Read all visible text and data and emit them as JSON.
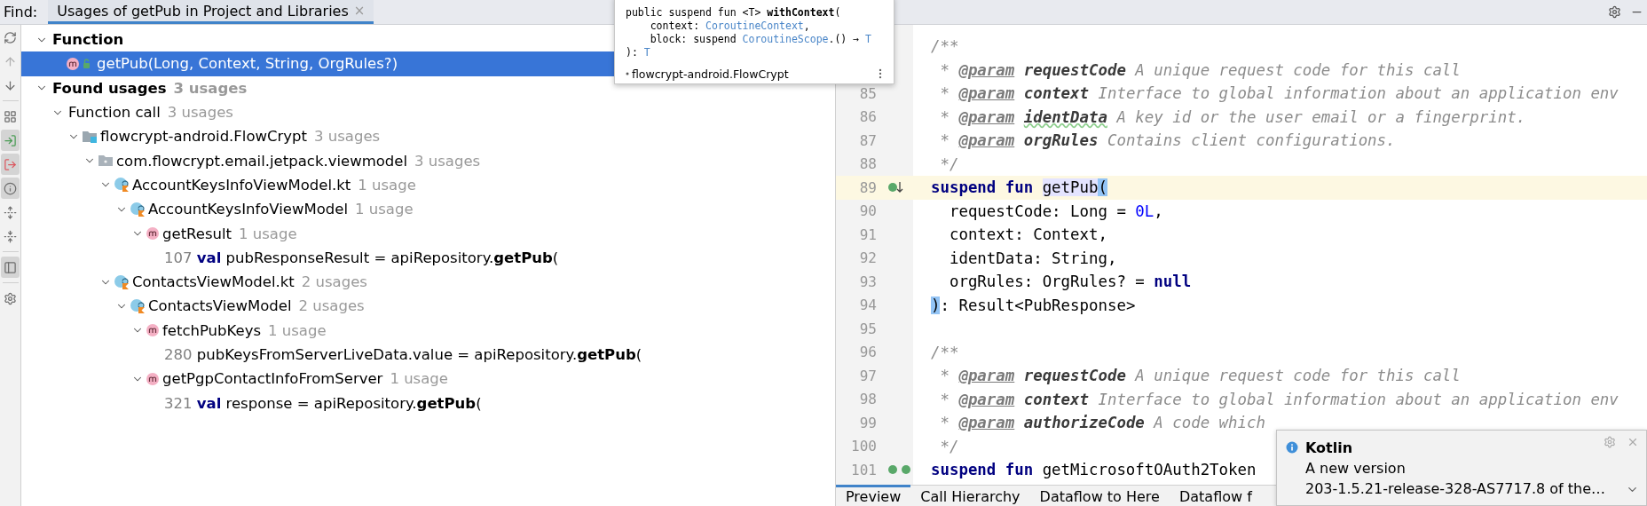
{
  "find_bar": {
    "label": "Find:",
    "tabs": [
      {
        "label": "Usages of getPub in Project and Libraries",
        "selected": true,
        "close": "×"
      }
    ]
  },
  "toolbar": [
    {
      "kind": "refresh",
      "on": false,
      "disabled": false
    },
    {
      "kind": "previous",
      "on": false,
      "disabled": true
    },
    {
      "kind": "next",
      "on": false,
      "disabled": false
    },
    {
      "kind": "separator"
    },
    {
      "kind": "group",
      "on": false,
      "disabled": false
    },
    {
      "kind": "import",
      "on": true,
      "disabled": false
    },
    {
      "kind": "export",
      "on": true,
      "disabled": false
    },
    {
      "kind": "info",
      "on": true,
      "disabled": false
    },
    {
      "kind": "expand",
      "on": false,
      "disabled": false
    },
    {
      "kind": "collapse",
      "on": false,
      "disabled": false
    },
    {
      "kind": "separator"
    },
    {
      "kind": "preview",
      "on": true,
      "disabled": false
    },
    {
      "kind": "separator"
    },
    {
      "kind": "settings",
      "on": false,
      "disabled": false
    }
  ],
  "tree": [
    {
      "kind": "group",
      "label": "Function",
      "expanded": true,
      "selected": false,
      "children": [
        {
          "kind": "function",
          "label": "getPub(Long, Context, String, OrgRules?)",
          "selected": true
        }
      ]
    },
    {
      "kind": "group",
      "label": "Found usages",
      "count": "3 usages",
      "expanded": true,
      "selected": false,
      "children": [
        {
          "kind": "category",
          "label": "Function call",
          "count": "3 usages",
          "expanded": true,
          "selected": false,
          "children": [
            {
              "kind": "module",
              "label": "flowcrypt-android.FlowCrypt",
              "count": "3 usages",
              "expanded": true,
              "selected": false,
              "children": [
                {
                  "kind": "package",
                  "label": "com.flowcrypt.email.jetpack.viewmodel",
                  "count": "3 usages",
                  "expanded": true,
                  "selected": false,
                  "children": [
                    {
                      "kind": "file",
                      "label": "AccountKeysInfoViewModel.kt",
                      "count": "1 usage",
                      "expanded": true,
                      "selected": false,
                      "children": [
                        {
                          "kind": "class",
                          "label": "AccountKeysInfoViewModel",
                          "count": "1 usage",
                          "expanded": true,
                          "selected": false,
                          "children": [
                            {
                              "kind": "method",
                              "label": "getResult",
                              "count": "1 usage",
                              "expanded": true,
                              "selected": false,
                              "children": [
                                {
                                  "kind": "usage",
                                  "line": "107",
                                  "selected": false,
                                  "code": [
                                    {
                                      "kind": "keyword",
                                      "text": "val"
                                    },
                                    {
                                      "kind": "plain",
                                      "text": " pubResponseResult = apiRepository."
                                    },
                                    {
                                      "kind": "match",
                                      "text": "getPub"
                                    },
                                    {
                                      "kind": "plain",
                                      "text": "("
                                    }
                                  ]
                                }
                              ]
                            }
                          ]
                        }
                      ]
                    },
                    {
                      "kind": "file",
                      "label": "ContactsViewModel.kt",
                      "count": "2 usages",
                      "expanded": true,
                      "selected": false,
                      "children": [
                        {
                          "kind": "class",
                          "label": "ContactsViewModel",
                          "count": "2 usages",
                          "expanded": true,
                          "selected": false,
                          "children": [
                            {
                              "kind": "method",
                              "label": "fetchPubKeys",
                              "count": "1 usage",
                              "expanded": true,
                              "selected": false,
                              "children": [
                                {
                                  "kind": "usage",
                                  "line": "280",
                                  "selected": false,
                                  "code": [
                                    {
                                      "kind": "plain",
                                      "text": "pubKeysFromServerLiveData.value = apiRepository."
                                    },
                                    {
                                      "kind": "match",
                                      "text": "getPub"
                                    },
                                    {
                                      "kind": "plain",
                                      "text": "("
                                    }
                                  ]
                                }
                              ]
                            },
                            {
                              "kind": "method",
                              "label": "getPgpContactInfoFromServer",
                              "count": "1 usage",
                              "expanded": true,
                              "selected": false,
                              "children": [
                                {
                                  "kind": "usage",
                                  "line": "321",
                                  "selected": false,
                                  "code": [
                                    {
                                      "kind": "keyword",
                                      "text": "val"
                                    },
                                    {
                                      "kind": "plain",
                                      "text": " response = apiRepository."
                                    },
                                    {
                                      "kind": "match",
                                      "text": "getPub"
                                    },
                                    {
                                      "kind": "plain",
                                      "text": "("
                                    }
                                  ]
                                }
                              ]
                            }
                          ]
                        }
                      ]
                    }
                  ]
                }
              ]
            }
          ]
        }
      ]
    }
  ],
  "popup": {
    "lines": [
      [
        {
          "kind": "plain",
          "text": "public suspend fun <T> "
        },
        {
          "kind": "bold",
          "text": "withContext"
        },
        {
          "kind": "plain",
          "text": "("
        }
      ],
      [
        {
          "kind": "plain",
          "text": "    context: "
        },
        {
          "kind": "type",
          "text": "CoroutineContext"
        },
        {
          "kind": "plain",
          "text": ","
        }
      ],
      [
        {
          "kind": "plain",
          "text": "    block: suspend "
        },
        {
          "kind": "type",
          "text": "CoroutineScope"
        },
        {
          "kind": "plain",
          "text": ".() → "
        },
        {
          "kind": "type",
          "text": "T"
        }
      ],
      [
        {
          "kind": "plain",
          "text": "): "
        },
        {
          "kind": "type",
          "text": "T"
        }
      ]
    ],
    "footer": "flowcrypt-android.FlowCrypt"
  },
  "editor": {
    "lines": [
      {
        "current": false,
        "tokens": [
          {
            "kind": "comment",
            "text": "/**"
          }
        ]
      },
      {
        "current": false,
        "tokens": [
          {
            "kind": "comment",
            "text": " * "
          },
          {
            "kind": "tag",
            "text": "@param"
          },
          {
            "kind": "param",
            "text": " requestCode"
          },
          {
            "kind": "comment",
            "text": " A unique request code for this call"
          }
        ]
      },
      {
        "number": "85",
        "current": false,
        "tokens": [
          {
            "kind": "comment",
            "text": " * "
          },
          {
            "kind": "tag",
            "text": "@param"
          },
          {
            "kind": "param",
            "text": " context"
          },
          {
            "kind": "comment",
            "text": " Interface to global information about an application env"
          }
        ]
      },
      {
        "number": "86",
        "current": false,
        "tokens": [
          {
            "kind": "comment",
            "text": " * "
          },
          {
            "kind": "tag",
            "text": "@param"
          },
          {
            "kind": "typo-param",
            "text": "identData"
          },
          {
            "kind": "comment",
            "text": " A key id or the user email or a fingerprint."
          }
        ]
      },
      {
        "number": "87",
        "current": false,
        "tokens": [
          {
            "kind": "comment",
            "text": " * "
          },
          {
            "kind": "tag",
            "text": "@param"
          },
          {
            "kind": "param",
            "text": " orgRules"
          },
          {
            "kind": "comment",
            "text": " Contains client configurations."
          }
        ]
      },
      {
        "number": "88",
        "current": false,
        "tokens": [
          {
            "kind": "comment",
            "text": " */"
          }
        ]
      },
      {
        "number": "89",
        "current": true,
        "markers": [
          {
            "kind": "implementation"
          }
        ],
        "tokens": [
          {
            "kind": "keyword",
            "text": "suspend fun "
          },
          {
            "kind": "ref",
            "text": "getPub"
          },
          {
            "kind": "brace",
            "text": "("
          }
        ]
      },
      {
        "number": "90",
        "current": false,
        "tokens": [
          {
            "kind": "plain",
            "text": "  requestCode: Long = "
          },
          {
            "kind": "number",
            "text": "0L"
          },
          {
            "kind": "plain",
            "text": ","
          }
        ]
      },
      {
        "number": "91",
        "current": false,
        "tokens": [
          {
            "kind": "plain",
            "text": "  context: Context,"
          }
        ]
      },
      {
        "number": "92",
        "current": false,
        "tokens": [
          {
            "kind": "plain",
            "text": "  identData: String,"
          }
        ]
      },
      {
        "number": "93",
        "current": false,
        "tokens": [
          {
            "kind": "plain",
            "text": "  orgRules: OrgRules? = "
          },
          {
            "kind": "keyword",
            "text": "null"
          }
        ]
      },
      {
        "number": "94",
        "current": false,
        "tokens": [
          {
            "kind": "brace",
            "text": ")"
          },
          {
            "kind": "plain",
            "text": ": Result<PubResponse>"
          }
        ]
      },
      {
        "number": "95",
        "current": false
      },
      {
        "number": "96",
        "current": false,
        "tokens": [
          {
            "kind": "comment",
            "text": "/**"
          }
        ]
      },
      {
        "number": "97",
        "current": false,
        "tokens": [
          {
            "kind": "comment",
            "text": " * "
          },
          {
            "kind": "tag",
            "text": "@param"
          },
          {
            "kind": "param",
            "text": " requestCode"
          },
          {
            "kind": "comment",
            "text": " A unique request code for this call"
          }
        ]
      },
      {
        "number": "98",
        "current": false,
        "tokens": [
          {
            "kind": "comment",
            "text": " * "
          },
          {
            "kind": "tag",
            "text": "@param"
          },
          {
            "kind": "param",
            "text": " context"
          },
          {
            "kind": "comment",
            "text": " Interface to global information about an application env"
          }
        ]
      },
      {
        "number": "99",
        "current": false,
        "tokens": [
          {
            "kind": "comment",
            "text": " * "
          },
          {
            "kind": "tag",
            "text": "@param"
          },
          {
            "kind": "param",
            "text": " authorizeCode"
          },
          {
            "kind": "comment",
            "text": " A code which"
          }
        ]
      },
      {
        "number": "100",
        "current": false,
        "tokens": [
          {
            "kind": "comment",
            "text": " */"
          }
        ]
      },
      {
        "number": "101",
        "current": false,
        "markers": [
          {
            "kind": "implemented"
          },
          {
            "kind": "implemented"
          }
        ],
        "tokens": [
          {
            "kind": "keyword",
            "text": "suspend fun"
          },
          {
            "kind": "plain",
            "text": " getMicrosoftOAuth2Token"
          }
        ]
      }
    ]
  },
  "bottom_tabs": [
    {
      "label": "Preview",
      "selected": true
    },
    {
      "label": "Call Hierarchy",
      "selected": false
    },
    {
      "label": "Dataflow to Here",
      "selected": false
    },
    {
      "label": "Dataflow f",
      "selected": false
    }
  ],
  "notification": {
    "title": "Kotlin",
    "lines": [
      "A new version",
      "203-1.5.21-release-328-AS7717.8 of the…"
    ]
  }
}
